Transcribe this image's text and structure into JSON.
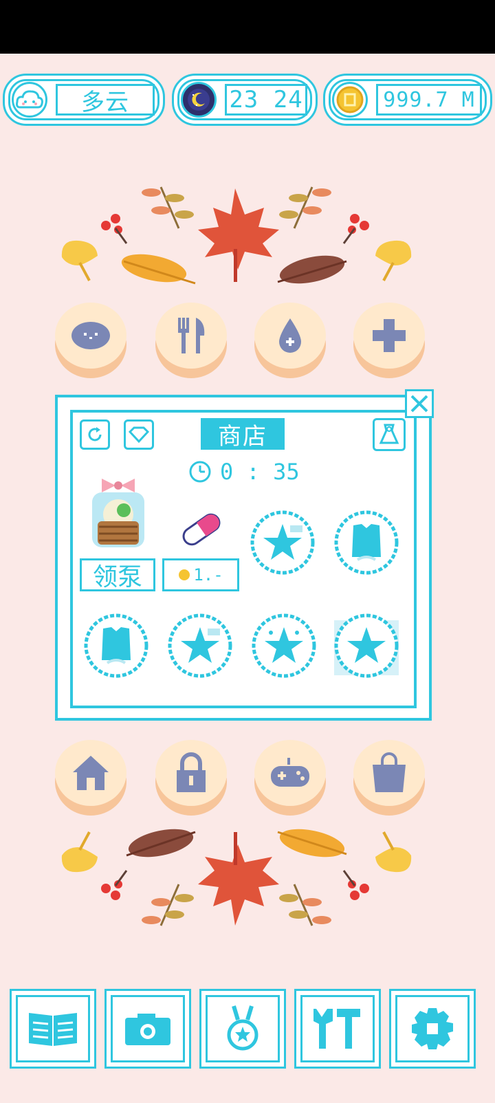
{
  "status": {
    "player_name": "多云",
    "time": "23 24",
    "coins": "999.7 M"
  },
  "actions_top": [
    {
      "name": "pet",
      "icon": "blob-face-icon"
    },
    {
      "name": "food",
      "icon": "fork-knife-icon"
    },
    {
      "name": "water",
      "icon": "water-drop-icon"
    },
    {
      "name": "heal",
      "icon": "plus-icon"
    }
  ],
  "shop": {
    "title": "商店",
    "timer": "0 : 35",
    "claim_label": "领泵",
    "pill_price": "1.-",
    "items": [
      {
        "icon": "basket-icon"
      },
      {
        "icon": "pill-capsule-icon"
      },
      {
        "icon": "star-stamp-icon"
      },
      {
        "icon": "shirt-stamp-icon"
      },
      {
        "icon": "shirt-stamp-icon"
      },
      {
        "icon": "star-stamp-icon"
      },
      {
        "icon": "star-stamp-icon"
      },
      {
        "icon": "star-stamp-icon"
      }
    ]
  },
  "actions_bottom": [
    {
      "name": "home",
      "icon": "house-icon"
    },
    {
      "name": "lock",
      "icon": "padlock-icon"
    },
    {
      "name": "game",
      "icon": "gamepad-icon"
    },
    {
      "name": "bag",
      "icon": "shopping-bag-icon"
    }
  ],
  "tabs": [
    {
      "name": "book",
      "icon": "book-icon"
    },
    {
      "name": "camera",
      "icon": "camera-icon"
    },
    {
      "name": "medal",
      "icon": "medal-icon"
    },
    {
      "name": "tools",
      "icon": "tools-icon"
    },
    {
      "name": "settings",
      "icon": "gear-icon"
    }
  ],
  "colors": {
    "accent": "#2fc6df",
    "background": "#fbe9e7",
    "button_top": "#ffe9cc",
    "button_base": "#f7c59a",
    "icon_slate": "#7b87b5"
  }
}
